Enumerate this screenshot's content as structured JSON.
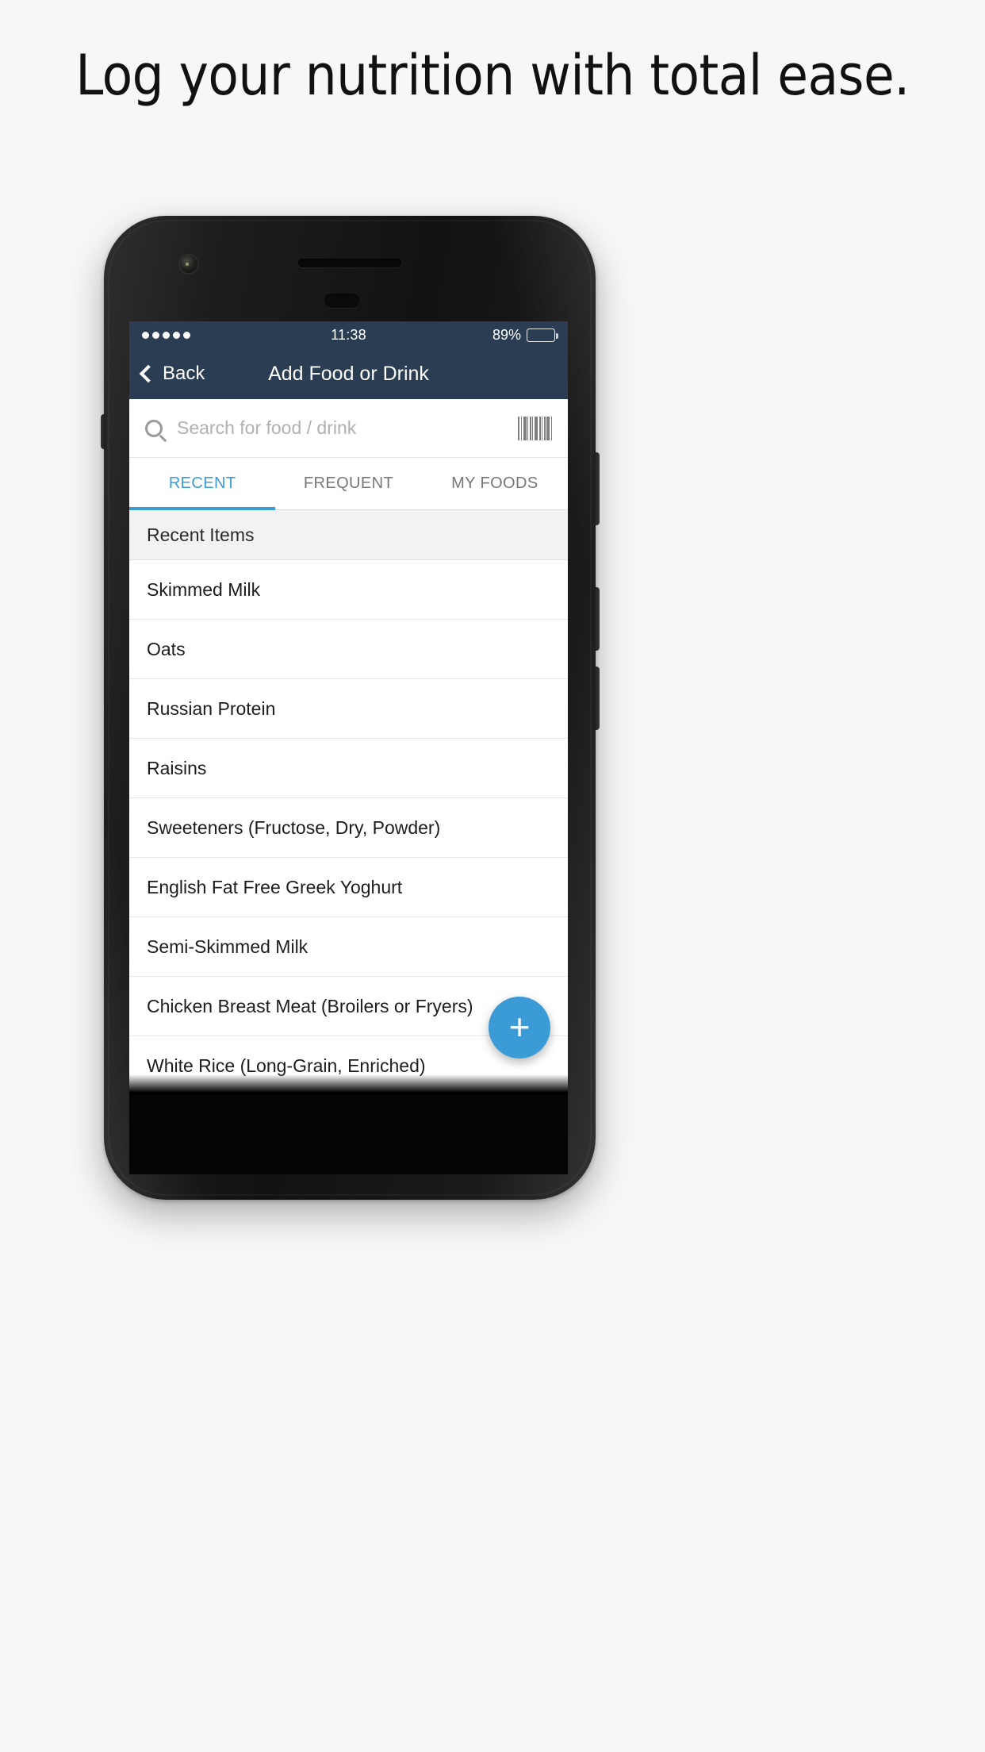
{
  "promo": {
    "headline": "Log your nutrition with total ease."
  },
  "status_bar": {
    "signal_dots": 5,
    "time": "11:38",
    "battery_percent": "89%",
    "battery_level": 89
  },
  "nav": {
    "back_label": "Back",
    "title": "Add Food or Drink",
    "back_icon": "chevron-left-icon"
  },
  "search": {
    "placeholder": "Search for food / drink",
    "value": "",
    "search_icon": "search-icon",
    "barcode_icon": "barcode-scanner-icon"
  },
  "tabs": [
    {
      "label": "RECENT",
      "active": true
    },
    {
      "label": "FREQUENT",
      "active": false
    },
    {
      "label": "MY FOODS",
      "active": false
    }
  ],
  "list": {
    "section_header": "Recent Items",
    "items": [
      "Skimmed Milk",
      "Oats",
      "Russian Protein",
      "Raisins",
      "Sweeteners (Fructose, Dry, Powder)",
      "English Fat Free Greek Yoghurt",
      "Semi-Skimmed Milk",
      "Chicken Breast Meat (Broilers or Fryers)",
      "White Rice (Long-Grain, Enriched)"
    ]
  },
  "fab": {
    "label": "+",
    "icon": "plus-icon"
  },
  "colors": {
    "accent": "#3b9bd6",
    "navbar": "#2b3d53",
    "page_background": "#f7f7f7",
    "list_header": "#f2f2f2"
  }
}
